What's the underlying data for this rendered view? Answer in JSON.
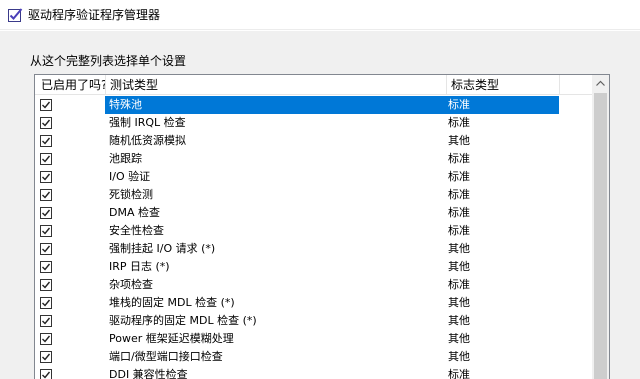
{
  "window": {
    "title": "驱动程序验证程序管理器",
    "icon": "checklist-icon"
  },
  "instruction": "从这个完整列表选择单个设置",
  "listview": {
    "columns": [
      {
        "label": "已启用了吗?"
      },
      {
        "label": "测试类型"
      },
      {
        "label": "标志类型"
      }
    ],
    "rows": [
      {
        "name": "特殊池",
        "type": "标准",
        "checked": true,
        "selected": true
      },
      {
        "name": "强制 IRQL 检查",
        "type": "标准",
        "checked": true
      },
      {
        "name": "随机低资源模拟",
        "type": "其他",
        "checked": true
      },
      {
        "name": "池跟踪",
        "type": "标准",
        "checked": true
      },
      {
        "name": "I/O 验证",
        "type": "标准",
        "checked": true
      },
      {
        "name": "死锁检测",
        "type": "标准",
        "checked": true
      },
      {
        "name": "DMA 检查",
        "type": "标准",
        "checked": true
      },
      {
        "name": "安全性检查",
        "type": "标准",
        "checked": true
      },
      {
        "name": "强制挂起 I/O 请求 (*)",
        "type": "其他",
        "checked": true
      },
      {
        "name": "IRP 日志 (*)",
        "type": "其他",
        "checked": true
      },
      {
        "name": "杂项检查",
        "type": "标准",
        "checked": true
      },
      {
        "name": "堆栈的固定 MDL 检查 (*)",
        "type": "其他",
        "checked": true
      },
      {
        "name": "驱动程序的固定 MDL 检查 (*)",
        "type": "其他",
        "checked": true
      },
      {
        "name": "Power 框架延迟模糊处理",
        "type": "其他",
        "checked": true
      },
      {
        "name": "端口/微型端口接口检查",
        "type": "其他",
        "checked": true
      },
      {
        "name": "DDI 兼容性检查",
        "type": "标准",
        "checked": true
      }
    ]
  },
  "colors": {
    "selection": "#0078d7",
    "window_bg": "#f0f0f0"
  }
}
